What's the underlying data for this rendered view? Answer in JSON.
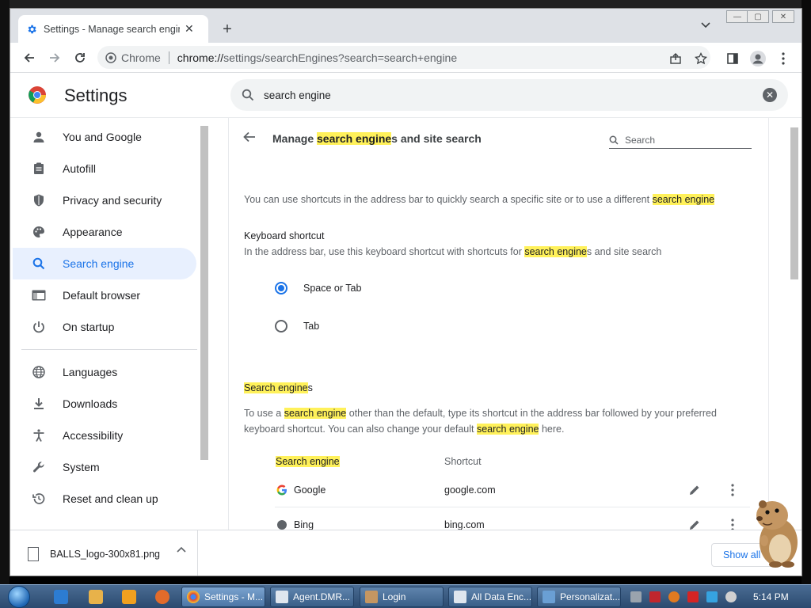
{
  "browser": {
    "tab_title": "Settings - Manage search engine",
    "new_tab_symbol": "+",
    "tab_close_symbol": "✕",
    "omnibox_chip": "Chrome",
    "url_host": "chrome://",
    "url_rest": "settings/searchEngines?search=search+engine"
  },
  "settings": {
    "title": "Settings",
    "search_value": "search engine"
  },
  "sidebar": {
    "items": [
      {
        "label": "You and Google",
        "icon": "person-icon"
      },
      {
        "label": "Autofill",
        "icon": "clipboard-icon"
      },
      {
        "label": "Privacy and security",
        "icon": "shield-icon"
      },
      {
        "label": "Appearance",
        "icon": "palette-icon"
      },
      {
        "label": "Search engine",
        "icon": "search-icon"
      },
      {
        "label": "Default browser",
        "icon": "browser-icon"
      },
      {
        "label": "On startup",
        "icon": "power-icon"
      },
      {
        "label": "Languages",
        "icon": "globe-icon"
      },
      {
        "label": "Downloads",
        "icon": "download-icon"
      },
      {
        "label": "Accessibility",
        "icon": "accessibility-icon"
      },
      {
        "label": "System",
        "icon": "wrench-icon"
      },
      {
        "label": "Reset and clean up",
        "icon": "history-icon"
      }
    ]
  },
  "main": {
    "title_pre": "Manage ",
    "title_hl": "search engine",
    "title_post": "s and site search",
    "search_placeholder": "Search",
    "intro_pre": "You can use shortcuts in the address bar to quickly search a specific site or to use a different ",
    "intro_hl": "search engine",
    "kb_heading": "Keyboard shortcut",
    "kb_desc_pre": "In the address bar, use this keyboard shortcut with shortcuts for ",
    "kb_desc_hl": "search engine",
    "kb_desc_post": "s and site search",
    "radio_1": "Space or Tab",
    "radio_2": "Tab",
    "se_heading_hl": "Search engine",
    "se_heading_post": "s",
    "se_desc_1": "To use a ",
    "se_desc_hl1": "search engine",
    "se_desc_2": " other than the default, type its shortcut in the address bar followed by your preferred",
    "se_desc_3": "keyboard shortcut. You can also change your default ",
    "se_desc_hl2": "search engine",
    "se_desc_4": " here.",
    "col_engine": "Search engine",
    "col_shortcut": "Shortcut",
    "engines": [
      {
        "name": "Google",
        "shortcut": "google.com"
      },
      {
        "name": "Bing",
        "shortcut": "bing.com"
      }
    ]
  },
  "downloads": {
    "file_name": "BALLS_logo-300x81.png",
    "show_all": "Show all"
  },
  "taskbar": {
    "buttons": [
      {
        "label": "Settings - M..."
      },
      {
        "label": "Agent.DMR..."
      },
      {
        "label": "Login"
      },
      {
        "label": "All Data Enc..."
      },
      {
        "label": "Personalizat..."
      }
    ],
    "clock": "5:14 PM"
  },
  "colors": {
    "accent": "#1a73e8",
    "highlight": "#fff15a",
    "active_nav_bg": "#e8f0fe"
  }
}
